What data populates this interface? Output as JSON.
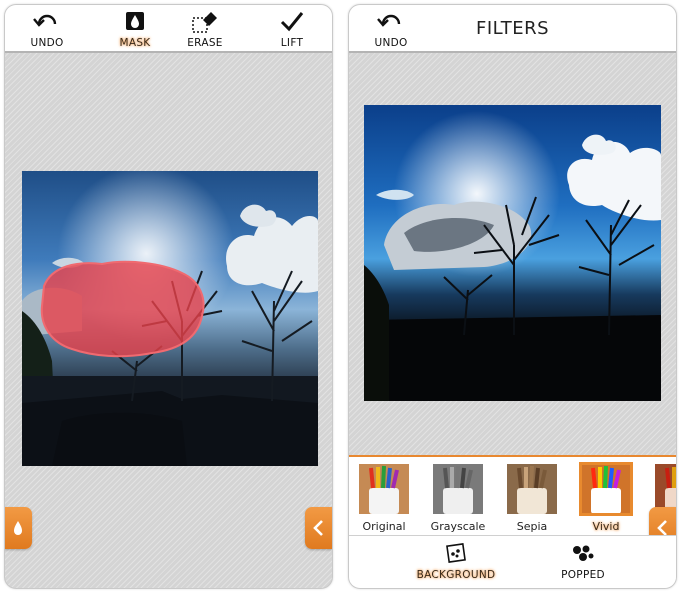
{
  "left_screen": {
    "toolbar": {
      "undo_label": "UNDO",
      "mask_label": "MASK",
      "erase_label": "ERASE",
      "lift_label": "LIFT",
      "active_tool": "MASK"
    },
    "mask_toggle_icon": "drop-icon",
    "collapse_icon": "chevron-left-icon",
    "mask_color": "#e8414a"
  },
  "right_screen": {
    "toolbar": {
      "undo_label": "UNDO",
      "title": "FILTERS"
    },
    "filters": [
      {
        "label": "Original",
        "active": false
      },
      {
        "label": "Grayscale",
        "active": false
      },
      {
        "label": "Sepia",
        "active": false
      },
      {
        "label": "Vivid",
        "active": true
      }
    ],
    "bottom_tabs": {
      "background_label": "BACKGROUND",
      "popped_label": "POPPED",
      "active_tab": "BACKGROUND"
    },
    "collapse_icon": "chevron-left-icon"
  },
  "colors": {
    "accent": "#e88a2e",
    "label_glow": "#f0a560"
  }
}
